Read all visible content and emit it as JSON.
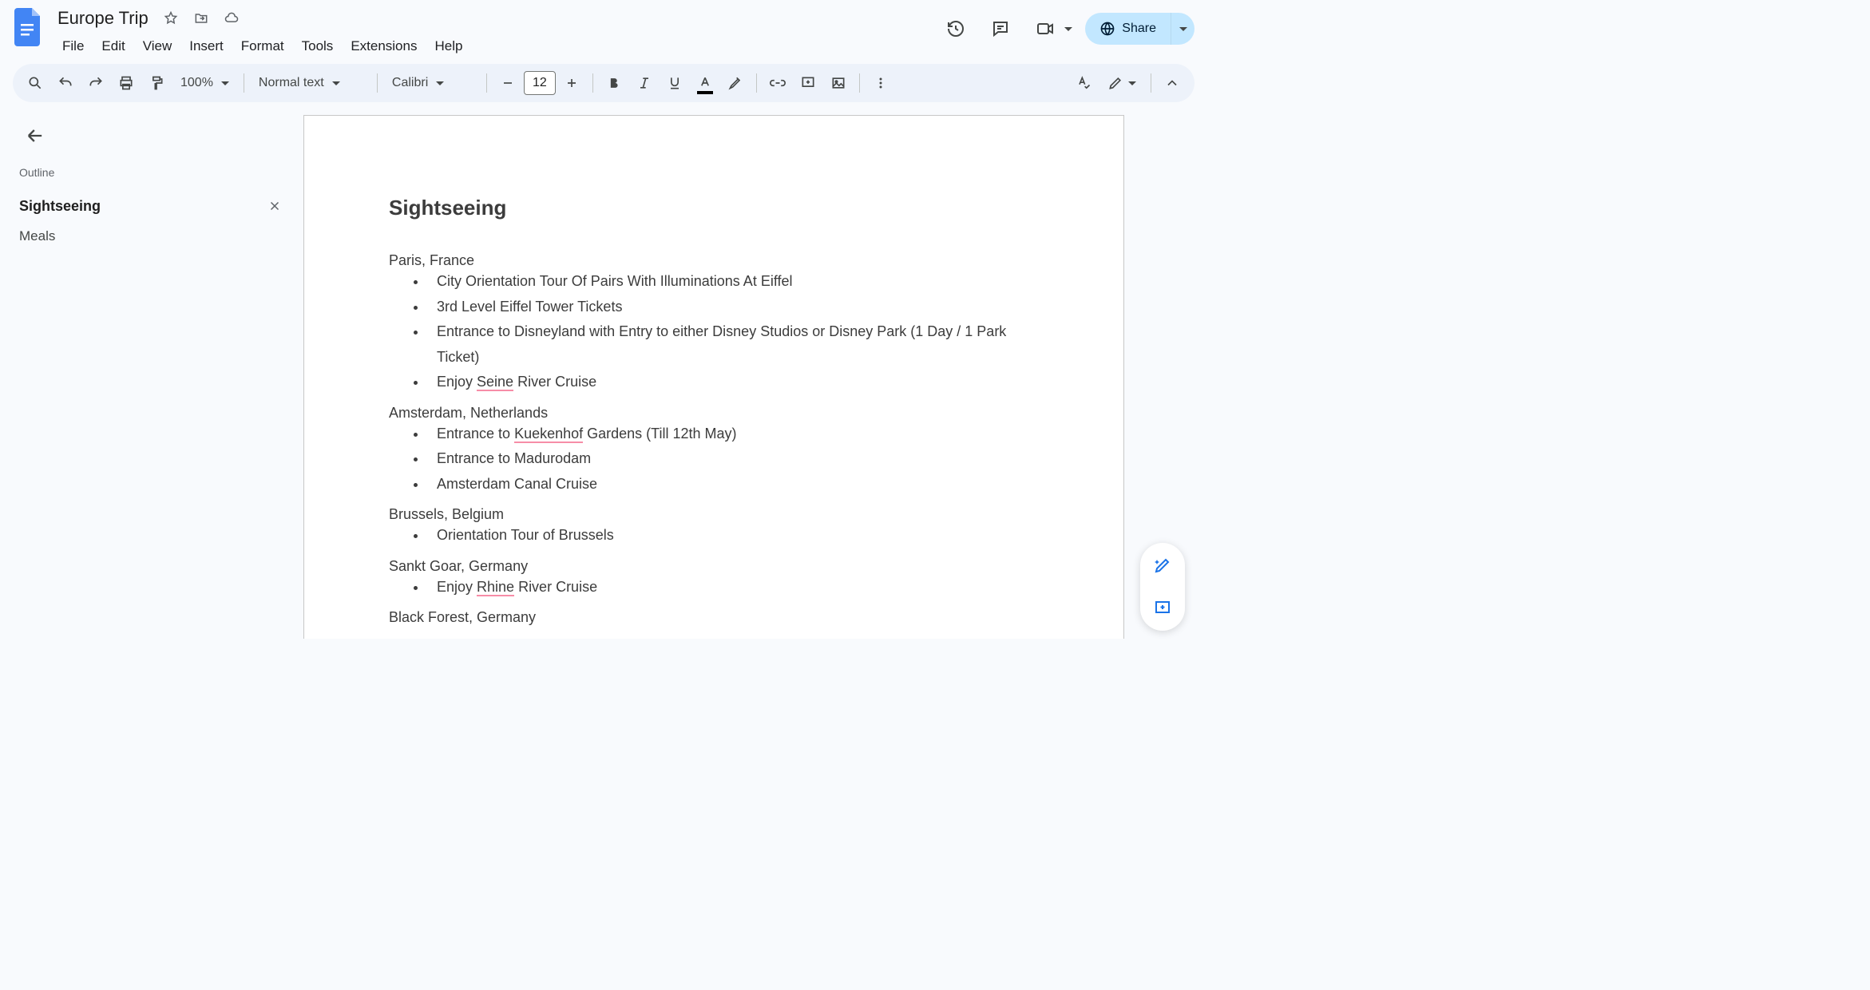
{
  "title": "Europe Trip",
  "menus": [
    "File",
    "Edit",
    "View",
    "Insert",
    "Format",
    "Tools",
    "Extensions",
    "Help"
  ],
  "share_label": "Share",
  "toolbar": {
    "zoom": "100%",
    "paragraph_style": "Normal text",
    "font": "Calibri",
    "font_size": "12"
  },
  "outline": {
    "title": "Outline",
    "items": [
      {
        "label": "Sightseeing",
        "active": true
      },
      {
        "label": "Meals",
        "active": false
      }
    ]
  },
  "doc": {
    "heading": "Sightseeing",
    "sections": [
      {
        "location": "Paris, France",
        "bullets": [
          {
            "pre": "City Orientation Tour Of Pairs With Illuminations At Eiffel"
          },
          {
            "pre": "3rd Level Eiffel Tower Tickets"
          },
          {
            "pre": "Entrance to Disneyland with Entry to either Disney Studios or Disney Park (1 Day / 1 Park Ticket)"
          },
          {
            "pre": "Enjoy ",
            "spell": "Seine",
            "post": " River Cruise"
          }
        ]
      },
      {
        "location": "Amsterdam, Netherlands",
        "bullets": [
          {
            "pre": "Entrance to ",
            "spell": "Kuekenhof",
            "post": " Gardens (Till 12th May)"
          },
          {
            "pre": "Entrance to Madurodam"
          },
          {
            "pre": "Amsterdam Canal Cruise"
          }
        ]
      },
      {
        "location": "Brussels, Belgium",
        "bullets": [
          {
            "pre": "Orientation Tour of Brussels"
          }
        ]
      },
      {
        "location": "Sankt Goar, Germany",
        "bullets": [
          {
            "pre": "Enjoy ",
            "spell": "Rhine",
            "post": " River Cruise"
          }
        ]
      },
      {
        "location": "Black Forest, Germany",
        "bullets": []
      }
    ]
  }
}
